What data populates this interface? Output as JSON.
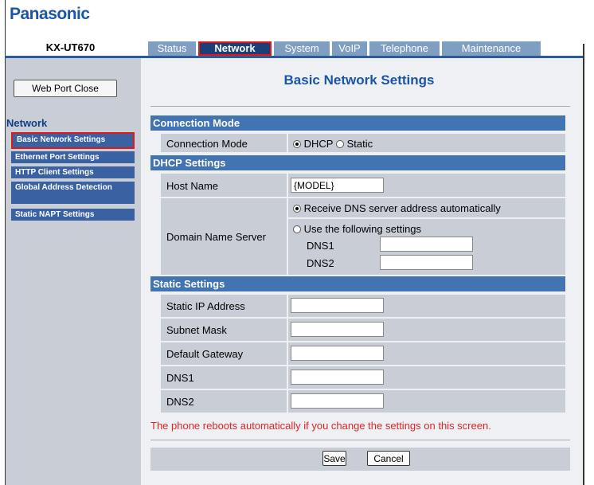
{
  "brand": {
    "logo": "Panasonic",
    "model": "KX-UT670"
  },
  "tabs": [
    {
      "label": "Status",
      "active": false
    },
    {
      "label": "Network",
      "active": true
    },
    {
      "label": "System",
      "active": false
    },
    {
      "label": "VoIP",
      "active": false
    },
    {
      "label": "Telephone",
      "active": false
    },
    {
      "label": "Maintenance",
      "active": false
    }
  ],
  "sidebar": {
    "web_port_close": "Web Port Close",
    "heading": "Network",
    "items": [
      {
        "label": "Basic Network Settings",
        "active": true
      },
      {
        "label": "Ethernet Port Settings",
        "active": false
      },
      {
        "label": "HTTP Client Settings",
        "active": false
      },
      {
        "label": "Global Address Detection",
        "active": false
      },
      {
        "label": "Static NAPT Settings",
        "active": false
      }
    ]
  },
  "page": {
    "title": "Basic Network Settings",
    "connection": {
      "heading": "Connection Mode",
      "label": "Connection Mode",
      "options": [
        "DHCP",
        "Static"
      ],
      "selected": "DHCP"
    },
    "dhcp": {
      "heading": "DHCP Settings",
      "host_name_label": "Host Name",
      "host_name_value": "{MODEL}",
      "dns_label": "Domain Name Server",
      "dns_auto_label": "Receive DNS server address automatically",
      "dns_manual_label": "Use the following settings",
      "dns_mode": "auto",
      "dns1_label": "DNS1",
      "dns1_value": "",
      "dns2_label": "DNS2",
      "dns2_value": ""
    },
    "static": {
      "heading": "Static Settings",
      "fields": [
        {
          "label": "Static IP Address",
          "value": ""
        },
        {
          "label": "Subnet Mask",
          "value": ""
        },
        {
          "label": "Default Gateway",
          "value": ""
        },
        {
          "label": "DNS1",
          "value": ""
        },
        {
          "label": "DNS2",
          "value": ""
        }
      ]
    },
    "warning": "The phone reboots automatically if you change the settings on this screen.",
    "save_label": "Save",
    "cancel_label": "Cancel"
  },
  "colors": {
    "brand_blue": "#1b55a6",
    "section_header": "#4274b3",
    "tab_inactive": "#7e9fc2",
    "tab_active": "#1c3f78",
    "highlight_red": "#e01818"
  }
}
